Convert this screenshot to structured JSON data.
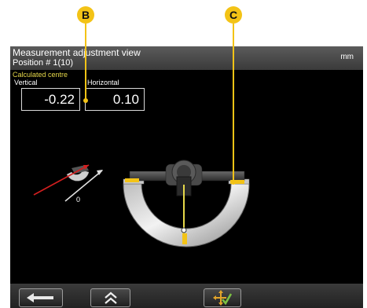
{
  "callouts": {
    "b": "B",
    "c": "C"
  },
  "header": {
    "title": "Measurement adjustment view",
    "subtitle": "Position # 1(10)",
    "unit": "mm"
  },
  "measurements": {
    "section_label": "Calculated centre",
    "vertical_label": "Vertical",
    "vertical_value": "-0.22",
    "horizontal_label": "Horizontal",
    "horizontal_value": "0.10"
  },
  "small_indicator": {
    "value": "0"
  },
  "toolbar": {
    "back_icon": "arrow-left-icon",
    "up_icon": "double-chevron-up-icon",
    "adjust_icon": "move-check-icon"
  },
  "colors": {
    "callout": "#f3c316",
    "accent_yellow": "#e6d84a",
    "check_green": "#7bc043",
    "arrow_red": "#d21f1f"
  }
}
